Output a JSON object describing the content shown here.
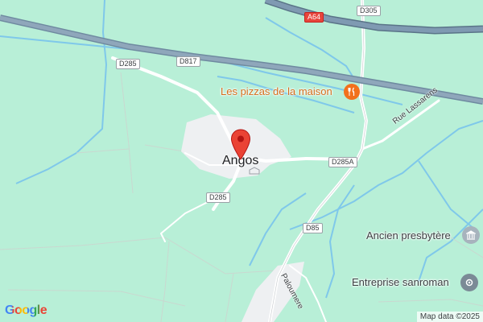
{
  "map": {
    "place_label": "Angos",
    "roads": {
      "motorway": "A64",
      "d305": "D305",
      "d817": "D817",
      "d285_top": "D285",
      "d285_bottom": "D285",
      "d285a": "D285A",
      "d85": "D85",
      "rue_lassarens": "Rue Lassarens",
      "paloumere": "Paloumere"
    },
    "pois": {
      "restaurant": "Les pizzas de la maison",
      "presbytere": "Ancien presbytère",
      "entreprise": "Entreprise sanroman"
    },
    "colors": {
      "background": "#b8efd7",
      "motorway": "#7f9ab2",
      "river": "#7fc8ea",
      "road": "#ffffff",
      "town": "#eef0f2",
      "restaurant_poi": "#f2711c",
      "pin": "#ea4335"
    },
    "icons": {
      "pin": "location-pin-icon",
      "restaurant": "fork-knife-icon",
      "presbytere": "monument-icon",
      "entreprise": "business-icon"
    }
  },
  "footer": {
    "logo": "Google",
    "attribution": "Map data ©2025"
  }
}
